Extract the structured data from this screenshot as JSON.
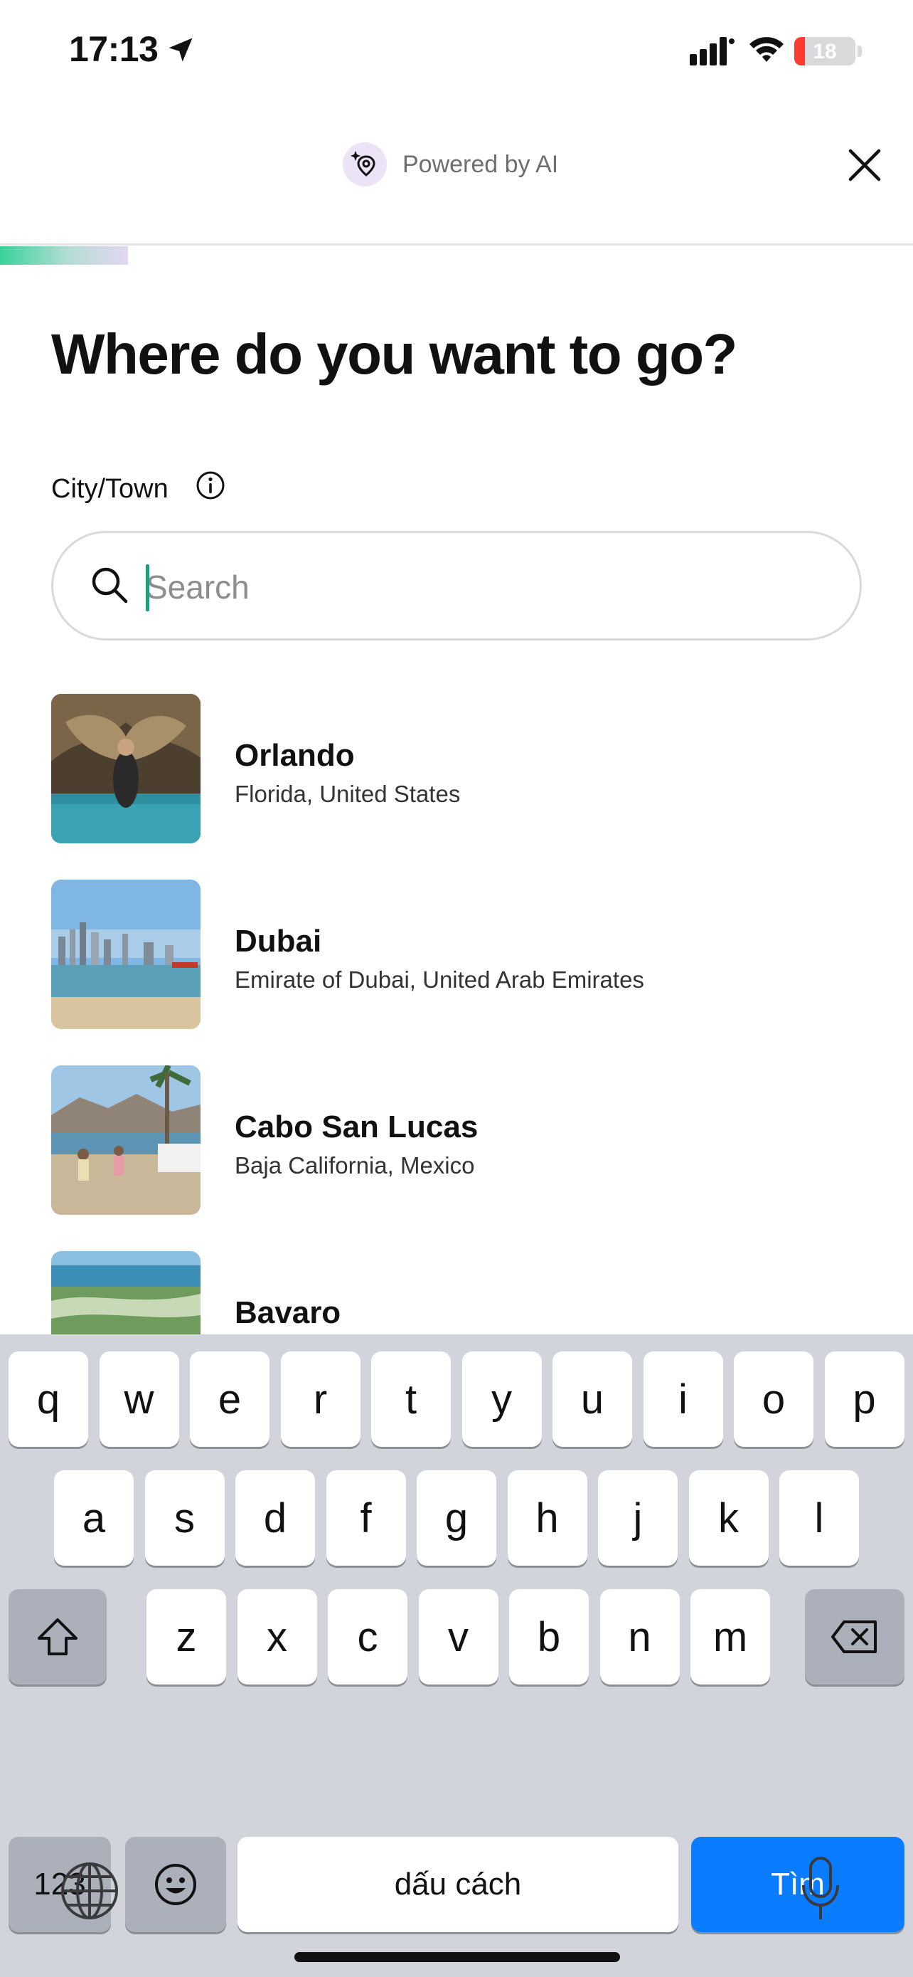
{
  "status_bar": {
    "time": "17:13",
    "battery_percent": "18",
    "battery_level": 0.18,
    "battery_color": "#ff3b30"
  },
  "header": {
    "badge_icon": "ai-location-sparkle-icon",
    "powered_by": "Powered by AI",
    "close_icon": "close-icon"
  },
  "progress": {
    "fraction": 0.14,
    "colors": [
      "#39d39a",
      "#e3d6f2"
    ]
  },
  "main": {
    "title": "Where do you want to go?",
    "field_label": "City/Town",
    "search": {
      "placeholder": "Search",
      "value": ""
    },
    "destinations": [
      {
        "name": "Orlando",
        "region": "Florida, United States"
      },
      {
        "name": "Dubai",
        "region": "Emirate of Dubai, United Arab Emirates"
      },
      {
        "name": "Cabo San Lucas",
        "region": "Baja California, Mexico"
      },
      {
        "name": "Bavaro",
        "region": ""
      }
    ]
  },
  "keyboard": {
    "row1": [
      "q",
      "w",
      "e",
      "r",
      "t",
      "y",
      "u",
      "i",
      "o",
      "p"
    ],
    "row2": [
      "a",
      "s",
      "d",
      "f",
      "g",
      "h",
      "j",
      "k",
      "l"
    ],
    "row3": [
      "z",
      "x",
      "c",
      "v",
      "b",
      "n",
      "m"
    ],
    "numbers_key": "123",
    "space_key": "dấu cách",
    "go_key": "Tìm",
    "accent_color": "#0a7cff"
  }
}
